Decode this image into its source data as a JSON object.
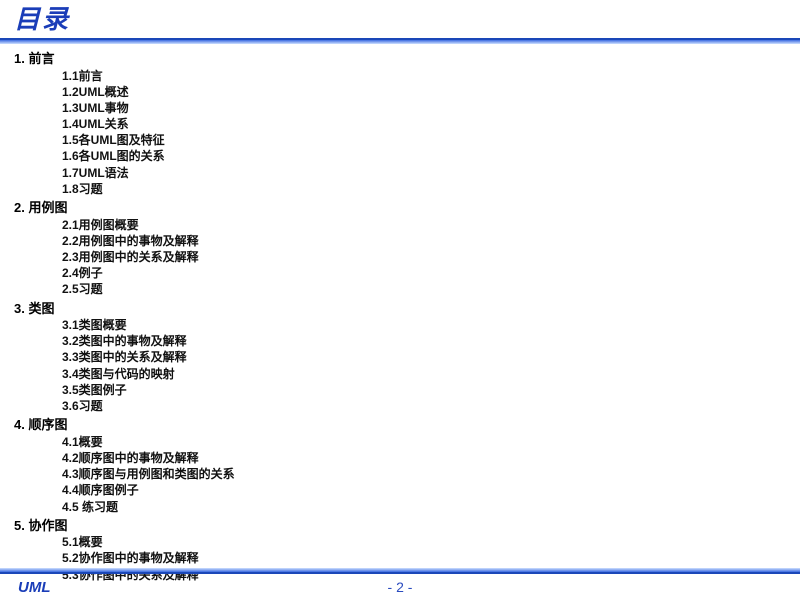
{
  "header": {
    "title": "目录"
  },
  "footer": {
    "left": "UML",
    "page": "- 2 -"
  },
  "toc": [
    {
      "num": "1.",
      "label": "前言",
      "items": [
        "1.1前言",
        "1.2UML概述",
        "1.3UML事物",
        "1.4UML关系",
        "1.5各UML图及特征",
        "1.6各UML图的关系",
        "1.7UML语法",
        "1.8习题"
      ]
    },
    {
      "num": "2.",
      "label": "用例图",
      "items": [
        "2.1用例图概要",
        "2.2用例图中的事物及解释",
        "2.3用例图中的关系及解释",
        "2.4例子",
        "2.5习题"
      ]
    },
    {
      "num": "3.",
      "label": "类图",
      "items": [
        "3.1类图概要",
        "3.2类图中的事物及解释",
        "3.3类图中的关系及解释",
        "3.4类图与代码的映射",
        "3.5类图例子",
        "3.6习题"
      ]
    },
    {
      "num": "4.",
      "label": "顺序图",
      "items": [
        "4.1概要",
        "4.2顺序图中的事物及解释",
        "4.3顺序图与用例图和类图的关系",
        "4.4顺序图例子",
        "4.5 练习题"
      ]
    },
    {
      "num": "5.",
      "label": "协作图",
      "items": [
        "5.1概要",
        "5.2协作图中的事物及解释",
        "5.3协作图中的关系及解释"
      ]
    }
  ]
}
